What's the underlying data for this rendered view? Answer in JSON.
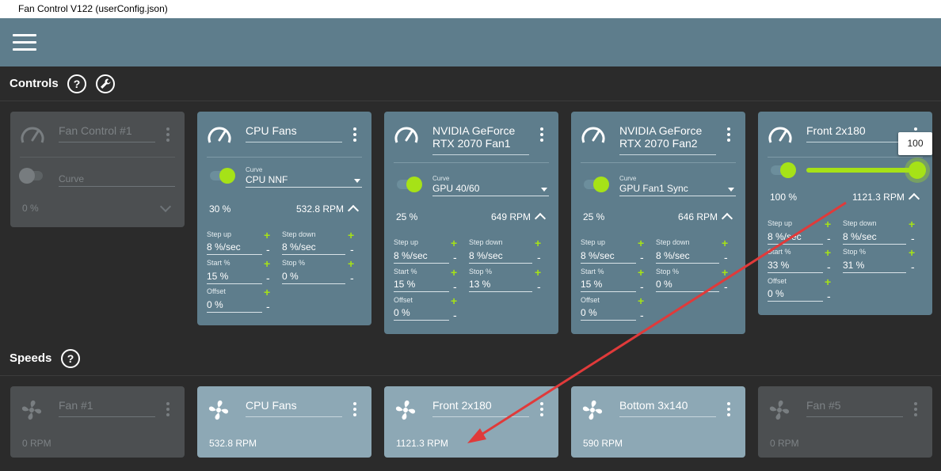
{
  "window": {
    "title": "Fan Control V122 (userConfig.json)"
  },
  "sections": {
    "controls": "Controls",
    "speeds": "Speeds"
  },
  "help_glyph": "?",
  "colors": {
    "appbar": "#5e7d8c",
    "accent": "#a6e217",
    "background": "#2b2b2b",
    "arrow": "#e03a3a"
  },
  "labels": {
    "curve": "Curve",
    "step_up": "Step up",
    "step_down": "Step down",
    "start": "Start %",
    "stop": "Stop %",
    "offset": "Offset",
    "plus": "+",
    "minus": "-"
  },
  "controls": [
    {
      "name": "Fan Control #1",
      "enabled": false,
      "curve": "Curve",
      "percent": "0 %"
    },
    {
      "name": "CPU Fans",
      "enabled": true,
      "curve": "CPU NNF",
      "percent": "30 %",
      "rpm": "532.8 RPM",
      "step_up": "8 %/sec",
      "step_down": "8 %/sec",
      "start": "15 %",
      "stop": "0 %",
      "offset": "0 %"
    },
    {
      "name": "NVIDIA GeForce RTX 2070 Fan1",
      "enabled": true,
      "curve": "GPU 40/60",
      "percent": "25 %",
      "rpm": "649 RPM",
      "step_up": "8 %/sec",
      "step_down": "8 %/sec",
      "start": "15 %",
      "stop": "13 %",
      "offset": "0 %"
    },
    {
      "name": "NVIDIA GeForce RTX 2070 Fan2",
      "enabled": true,
      "curve": "GPU Fan1 Sync",
      "percent": "25 %",
      "rpm": "646 RPM",
      "step_up": "8 %/sec",
      "step_down": "8 %/sec",
      "start": "15 %",
      "stop": "0 %",
      "offset": "0 %"
    },
    {
      "name": "Front 2x180",
      "enabled": true,
      "manual_value": 100,
      "slider_tooltip": "100",
      "percent": "100 %",
      "rpm": "1121.3 RPM",
      "step_up": "8 %/sec",
      "step_down": "8 %/sec",
      "start": "33 %",
      "stop": "31 %",
      "offset": "0 %"
    }
  ],
  "speeds": [
    {
      "name": "Fan #1",
      "rpm": "0 RPM",
      "enabled": false
    },
    {
      "name": "CPU Fans",
      "rpm": "532.8 RPM",
      "enabled": true
    },
    {
      "name": "Front 2x180",
      "rpm": "1121.3 RPM",
      "enabled": true
    },
    {
      "name": "Bottom 3x140",
      "rpm": "590 RPM",
      "enabled": true
    },
    {
      "name": "Fan #5",
      "rpm": "0 RPM",
      "enabled": false
    }
  ]
}
